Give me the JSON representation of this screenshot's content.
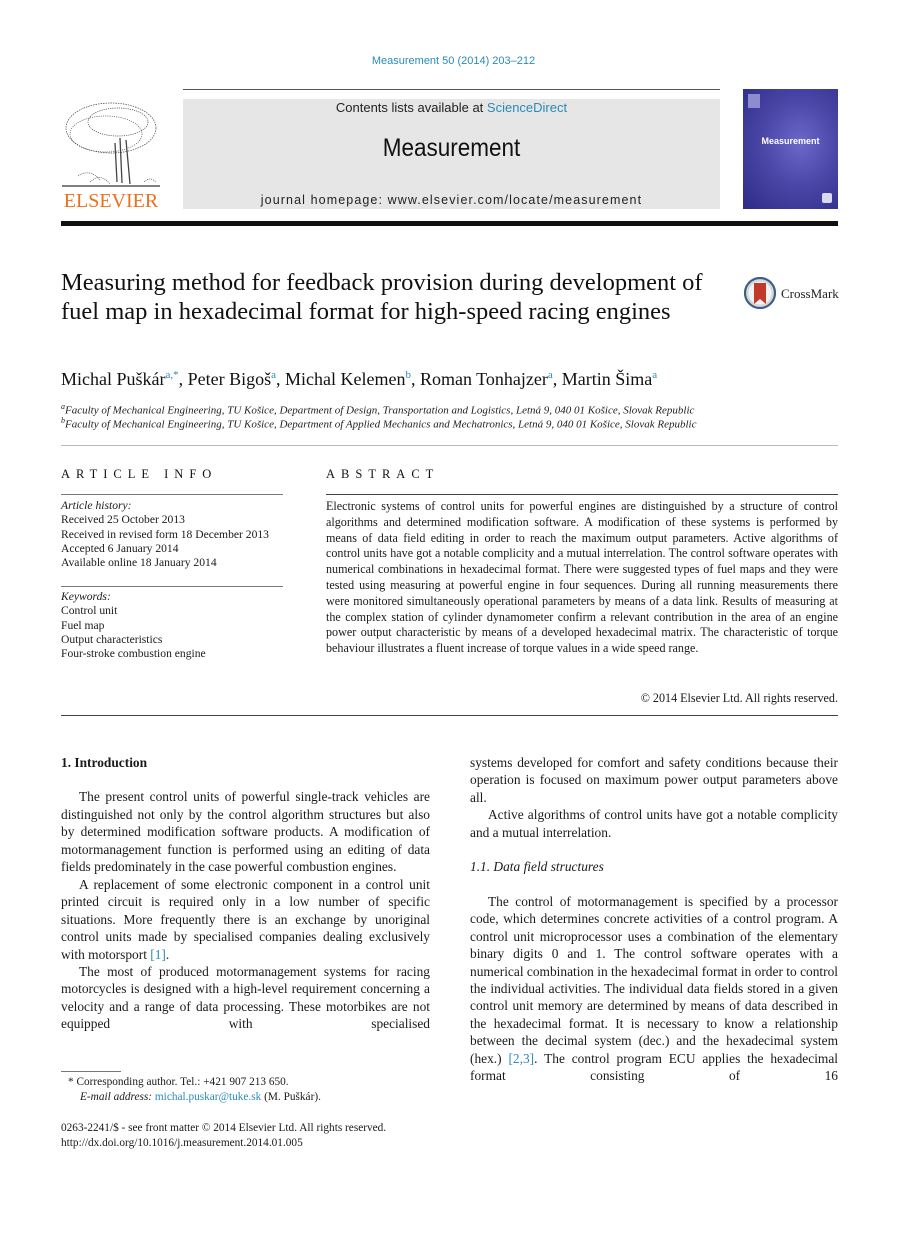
{
  "header": {
    "citation": "Measurement 50 (2014) 203–212",
    "contents_prefix": "Contents lists available at ",
    "contents_link": "ScienceDirect",
    "journal_name": "Measurement",
    "homepage": "journal homepage: www.elsevier.com/locate/measurement",
    "publisher_logo_text": "ELSEVIER",
    "cover_title": "Measurement",
    "colors": {
      "link": "#2b8ab8",
      "elsevier_orange": "#e9711c",
      "cover_blue": "#4a47a8",
      "header_box": "#e6e6e6"
    }
  },
  "article": {
    "title": "Measuring method for feedback provision during development of fuel map in hexadecimal format for high-speed racing engines",
    "crossmark_label": "CrossMark",
    "authors": [
      {
        "name": "Michal Puškár",
        "sup": "a,*",
        "sep": ", "
      },
      {
        "name": "Peter Bigoš",
        "sup": "a",
        "sep": ", "
      },
      {
        "name": "Michal Kelemen",
        "sup": "b",
        "sep": ", "
      },
      {
        "name": "Roman Tonhajzer",
        "sup": "a",
        "sep": ", "
      },
      {
        "name": "Martin Šima",
        "sup": "a",
        "sep": ""
      }
    ],
    "affiliations": [
      {
        "mark": "a",
        "text": "Faculty of Mechanical Engineering, TU Košice, Department of Design, Transportation and Logistics, Letná 9, 040 01 Košice, Slovak Republic"
      },
      {
        "mark": "b",
        "text": "Faculty of Mechanical Engineering, TU Košice, Department of Applied Mechanics and Mechatronics, Letná 9, 040 01 Košice, Slovak Republic"
      }
    ]
  },
  "article_info": {
    "heading": "ARTICLE INFO",
    "history_label": "Article history:",
    "history": [
      "Received 25 October 2013",
      "Received in revised form 18 December 2013",
      "Accepted 6 January 2014",
      "Available online 18 January 2014"
    ],
    "keywords_label": "Keywords:",
    "keywords": [
      "Control unit",
      "Fuel map",
      "Output characteristics",
      "Four-stroke combustion engine"
    ]
  },
  "abstract": {
    "heading": "ABSTRACT",
    "text": "Electronic systems of control units for powerful engines are distinguished by a structure of control algorithms and determined modification software. A modification of these systems is performed by means of data field editing in order to reach the maximum output parameters. Active algorithms of control units have got a notable complicity and a mutual interrelation. The control software operates with numerical combinations in hexadecimal format. There were suggested types of fuel maps and they were tested using measuring at powerful engine in four sequences. During all running measurements there were monitored simultaneously operational parameters by means of a data link. Results of measuring at the complex station of cylinder dynamometer confirm a relevant contribution in the area of an engine power output characteristic by means of a developed hexadecimal matrix. The characteristic of torque behaviour illustrates a fluent increase of torque values in a wide speed range.",
    "copyright": "© 2014 Elsevier Ltd. All rights reserved."
  },
  "body": {
    "section1_heading": "1. Introduction",
    "p1": "The present control units of powerful single-track vehicles are distinguished not only by the control algorithm structures but also by determined modification software products. A modification of motormanagement function is performed using an editing of data fields predominately in the case powerful combustion engines.",
    "p2_text": "A replacement of some electronic component in a control unit printed circuit is required only in a low number of specific situations. More frequently there is an exchange by unoriginal control units made by specialised companies dealing exclusively with motorsport ",
    "p2_ref": "[1]",
    "p2_end": ".",
    "p3": "The most of produced motormanagement systems for racing motorcycles is designed with a high-level requirement concerning a velocity and a range of data processing. These motorbikes are not equipped with specialised",
    "p3_cont": "systems developed for comfort and safety conditions because their operation is focused on maximum power output parameters above all.",
    "p4": "Active algorithms of control units have got a notable complicity and a mutual interrelation.",
    "subsection_heading": "1.1. Data field structures",
    "p5_text": "The control of motormanagement is specified by a processor code, which determines concrete activities of a control program. A control unit microprocessor uses a combination of the elementary binary digits 0 and 1. The control software operates with a numerical combination in the hexadecimal format in order to control the individual activities. The individual data fields stored in a given control unit memory are determined by means of data described in the hexadecimal format. It is necessary to know a relationship between the decimal system (dec.) and the hexadecimal system (hex.) ",
    "p5_ref": "[2,3]",
    "p5_end": ". The control program ECU applies the hexadecimal format consisting of 16"
  },
  "footnotes": {
    "corresponding": "* Corresponding author. Tel.: +421 907 213 650.",
    "email_label": "E-mail address: ",
    "email": "michal.puskar@tuke.sk",
    "email_suffix": " (M. Puškár).",
    "issn": "0263-2241/$ - see front matter © 2014 Elsevier Ltd. All rights reserved.",
    "doi": "http://dx.doi.org/10.1016/j.measurement.2014.01.005"
  }
}
